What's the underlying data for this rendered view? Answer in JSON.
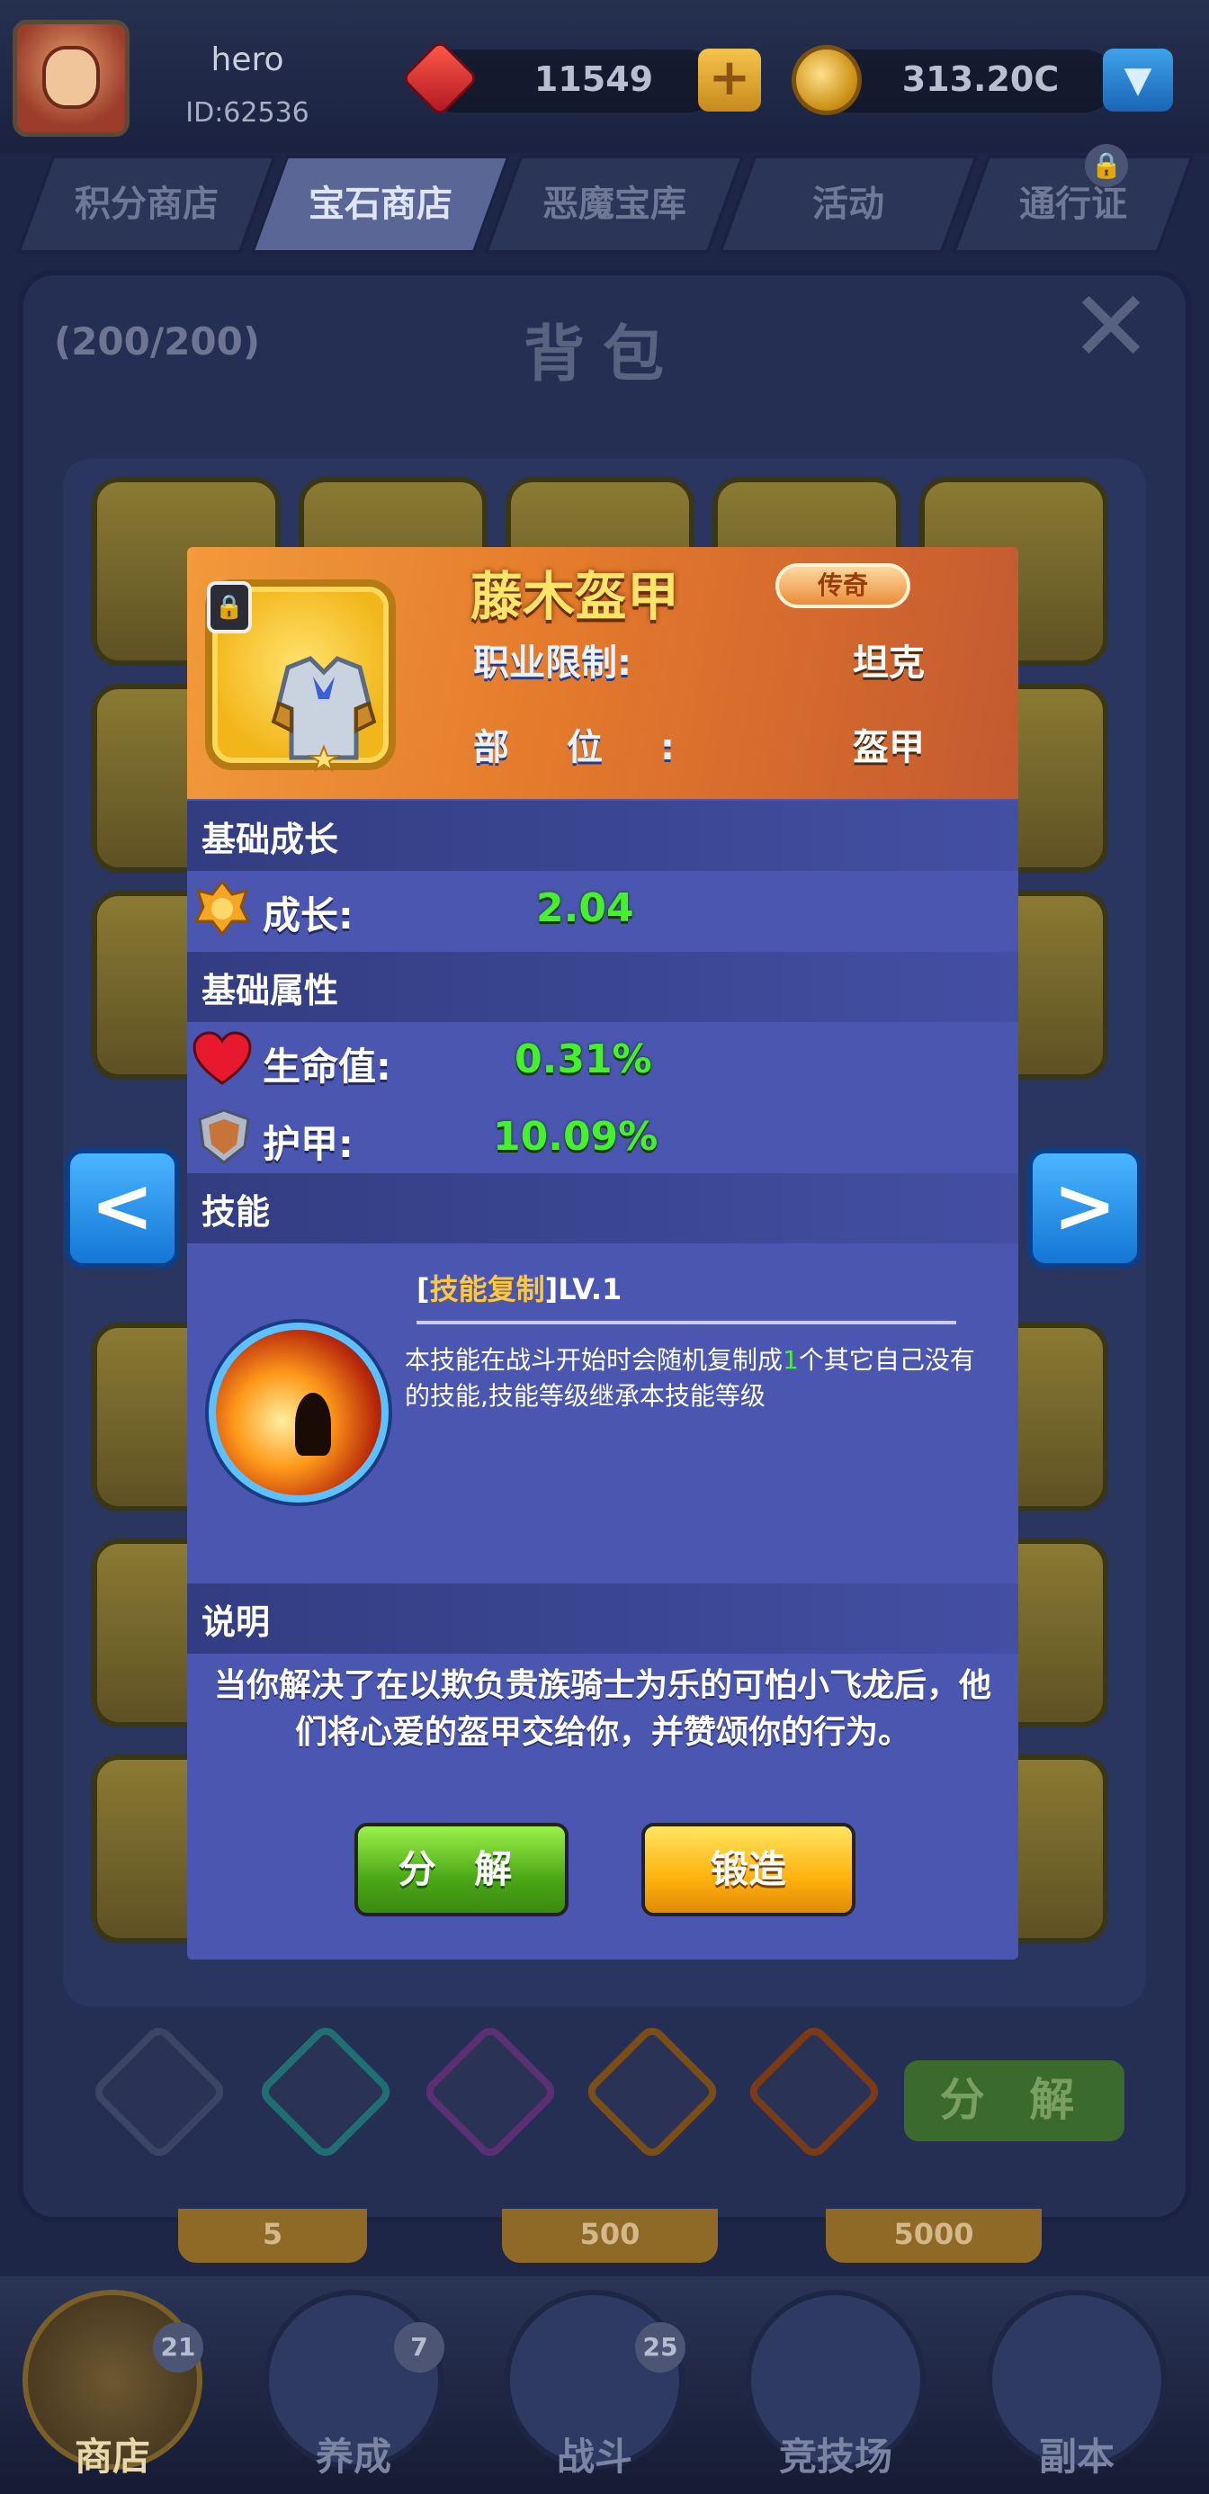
{
  "player": {
    "name": "hero",
    "id": "ID:62536"
  },
  "resources": {
    "gems": "11549",
    "coins": "313.20C",
    "add_symbol": "+",
    "dropdown_symbol": "▼"
  },
  "tabs": [
    {
      "label": "积分商店"
    },
    {
      "label": "宝石商店"
    },
    {
      "label": "恶魔宝库"
    },
    {
      "label": "活动"
    },
    {
      "label": "通行证"
    }
  ],
  "bag": {
    "count": "(200/200)",
    "title": "背包",
    "close_symbol": "✕",
    "decompose_all": "分 解",
    "prices": [
      "5",
      "500",
      "5000"
    ]
  },
  "item": {
    "name": "藤木盔甲",
    "rarity": "传奇",
    "class_label": "职业限制:",
    "class_value": "坦克",
    "slot_label": "部位:",
    "slot_value": "盔甲"
  },
  "sections": {
    "growth": "基础成长",
    "attributes": "基础属性",
    "skill": "技能",
    "description": "说明"
  },
  "stats": {
    "growth_label": "成长:",
    "growth_value": "2.04",
    "hp_label": "生命值:",
    "hp_value": "0.31%",
    "armor_label": "护甲:",
    "armor_value": "10.09%"
  },
  "skill": {
    "bracket_open": "[",
    "name": "技能复制",
    "bracket_close": "]LV.1",
    "desc_before": "本技能在战斗开始时会随机复制成",
    "desc_number": "1",
    "desc_after": "个其它自己没有的技能,技能等级继承本技能等级"
  },
  "description": "当你解决了在以欺负贵族骑士为乐的可怕小飞龙后，他们将心爱的盔甲交给你，并赞颂你的行为。",
  "actions": {
    "decompose": "分 解",
    "forge": "锻造"
  },
  "arrows": {
    "prev": "<",
    "next": ">"
  },
  "nav": [
    {
      "label": "商店",
      "badge": "21"
    },
    {
      "label": "养成",
      "badge": "7"
    },
    {
      "label": "战斗",
      "badge": "25"
    },
    {
      "label": "竞技场",
      "badge": ""
    },
    {
      "label": "副本",
      "badge": ""
    }
  ],
  "colors": {
    "modal_bg": "#4a56b0",
    "header_orange": "#e47a2c",
    "stat_green": "#46f02e",
    "item_name_yellow": "#ffe46a"
  }
}
